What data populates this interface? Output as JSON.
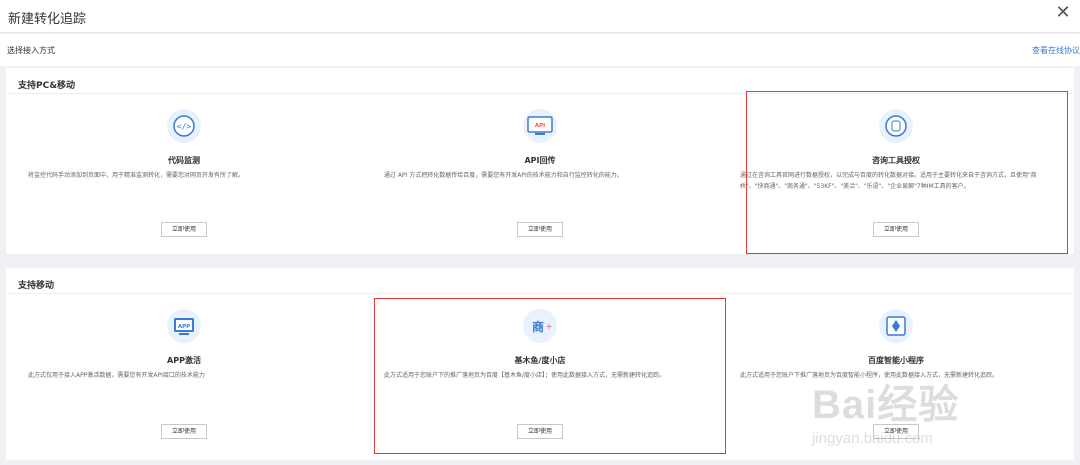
{
  "modal": {
    "title": "新建转化追踪",
    "close_icon": "close-icon"
  },
  "method": {
    "label": "选择接入方式",
    "help_link": "查看在线协议"
  },
  "section_pc": {
    "title": "支持PC&移动",
    "cards": [
      {
        "icon": "code-icon",
        "title": "代码监测",
        "desc": "将监控代码手动添加到页面中，用于精准监测转化，需要您对网页开发有所了解。",
        "button": "立即使用"
      },
      {
        "icon": "api-icon",
        "title": "API回传",
        "desc": "通过 API 方式把转化数据传给百度，需要您有开发API的技术能力和自行监控转化的能力。",
        "button": "立即使用"
      },
      {
        "icon": "chat-icon",
        "title": "咨询工具授权",
        "desc": "通过在咨询工具官网进行数据授权，以完成与百度的转化数据对接。适用于主要转化来自于咨询方式，且使用\"商桥\"、\"快商通\"、\"商务通\"、\"53KF\"、\"美洽\"、\"乐语\"、\"企业易聊\"7种IM工具的客户。",
        "button": "立即使用"
      }
    ]
  },
  "section_mobile": {
    "title": "支持移动",
    "cards": [
      {
        "icon": "app-icon",
        "title": "APP激活",
        "desc": "此方式仅用于接入APP激活数据，需要您有开发API接口的技术能力",
        "button": "立即使用"
      },
      {
        "icon": "shop-icon",
        "title": "基木鱼/度小店",
        "desc": "此方式适用于您账户下的推广落地页为百度【基木鱼/度小店】；使用此数据接入方式，无需新建转化追踪。",
        "button": "立即使用"
      },
      {
        "icon": "mini-program-icon",
        "title": "百度智能小程序",
        "desc": "此方式适用于您账户下推广落地页为百度智能小程序，使用此数据接入方式，无需新建转化追踪。",
        "button": "立即使用"
      }
    ]
  },
  "watermark": {
    "main": "Bai经验",
    "sub": "jingyan.baidu.com"
  },
  "colors": {
    "accent": "#3a7bd5",
    "highlight": "#e03a3a",
    "background": "#f0f1f4"
  }
}
